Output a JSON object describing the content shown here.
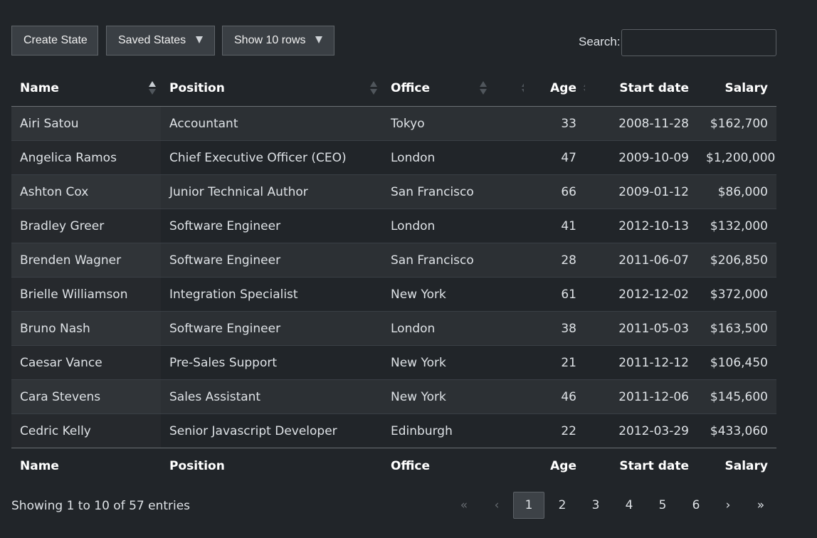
{
  "toolbar": {
    "create_state": "Create State",
    "saved_states": "Saved States",
    "show_rows": "Show 10 rows"
  },
  "search": {
    "label": "Search:",
    "value": "",
    "placeholder": ""
  },
  "table": {
    "columns": [
      "Name",
      "Position",
      "Office",
      "Age",
      "Start date",
      "Salary"
    ],
    "footer": [
      "Name",
      "Position",
      "Office",
      "Age",
      "Start date",
      "Salary"
    ],
    "sort": {
      "column": "Name",
      "direction": "ascending"
    },
    "rows": [
      [
        "Airi Satou",
        "Accountant",
        "Tokyo",
        "33",
        "2008-11-28",
        "$162,700"
      ],
      [
        "Angelica Ramos",
        "Chief Executive Officer (CEO)",
        "London",
        "47",
        "2009-10-09",
        "$1,200,000"
      ],
      [
        "Ashton Cox",
        "Junior Technical Author",
        "San Francisco",
        "66",
        "2009-01-12",
        "$86,000"
      ],
      [
        "Bradley Greer",
        "Software Engineer",
        "London",
        "41",
        "2012-10-13",
        "$132,000"
      ],
      [
        "Brenden Wagner",
        "Software Engineer",
        "San Francisco",
        "28",
        "2011-06-07",
        "$206,850"
      ],
      [
        "Brielle Williamson",
        "Integration Specialist",
        "New York",
        "61",
        "2012-12-02",
        "$372,000"
      ],
      [
        "Bruno Nash",
        "Software Engineer",
        "London",
        "38",
        "2011-05-03",
        "$163,500"
      ],
      [
        "Caesar Vance",
        "Pre-Sales Support",
        "New York",
        "21",
        "2011-12-12",
        "$106,450"
      ],
      [
        "Cara Stevens",
        "Sales Assistant",
        "New York",
        "46",
        "2011-12-06",
        "$145,600"
      ],
      [
        "Cedric Kelly",
        "Senior Javascript Developer",
        "Edinburgh",
        "22",
        "2012-03-29",
        "$433,060"
      ]
    ]
  },
  "info": "Showing 1 to 10 of 57 entries",
  "pagination": {
    "first": "«",
    "previous": "‹",
    "pages": [
      "1",
      "2",
      "3",
      "4",
      "5",
      "6"
    ],
    "current": "1",
    "next": "›",
    "last": "»"
  },
  "colors": {
    "background": "#212529",
    "button": "#3a3f44",
    "text": "#dee2e6"
  }
}
